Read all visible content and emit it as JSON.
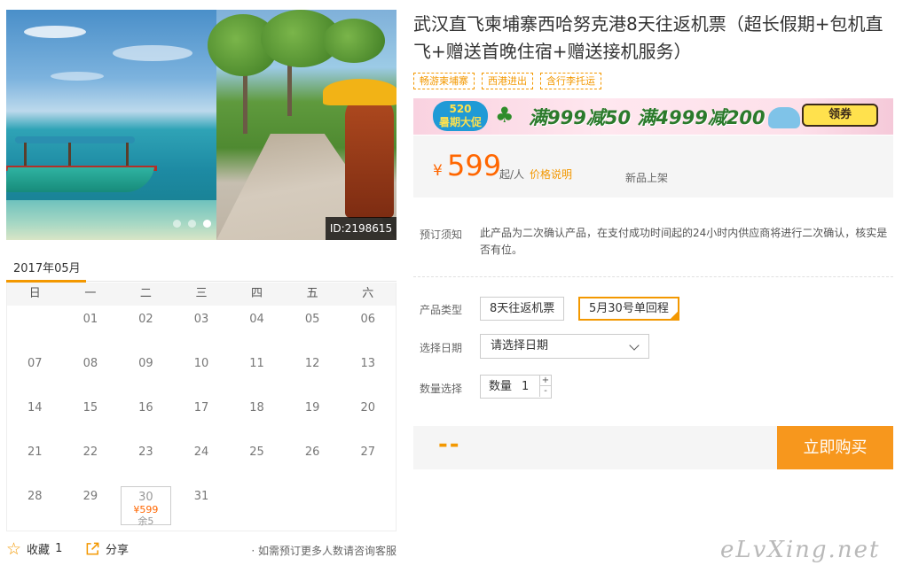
{
  "gallery": {
    "id_label": "ID:2198615",
    "dots": 3,
    "active_dot": 2
  },
  "calendar": {
    "month": "2017年05月",
    "weekdays": [
      "日",
      "一",
      "二",
      "三",
      "四",
      "五",
      "六"
    ],
    "start_offset": 1,
    "days": [
      "01",
      "02",
      "03",
      "04",
      "05",
      "06",
      "07",
      "08",
      "09",
      "10",
      "11",
      "12",
      "13",
      "14",
      "15",
      "16",
      "17",
      "18",
      "19",
      "20",
      "21",
      "22",
      "23",
      "24",
      "25",
      "26",
      "27",
      "28",
      "29",
      "30",
      "31"
    ],
    "available": {
      "30": {
        "price": "¥599",
        "stock": "余5"
      }
    }
  },
  "actions": {
    "favorite_label": "收藏",
    "favorite_count": "1",
    "share_label": "分享",
    "contact_note": "· 如需预订更多人数请咨询客服"
  },
  "product": {
    "title": "武汉直飞柬埔寨西哈努克港8天往返机票（超长假期+包机直飞+赠送首晚住宿+赠送接机服务）",
    "tags": [
      "畅游柬埔寨",
      "西港进出",
      "含行李托运"
    ]
  },
  "promo": {
    "badge_line1": "520",
    "badge_line2": "暑期大促",
    "text": "满999减50 满4999减200",
    "button": "领券"
  },
  "price": {
    "currency": "¥",
    "value": "599",
    "unit": "起/人",
    "info_link": "价格说明",
    "status": "新品上架"
  },
  "notice": {
    "label": "预订须知",
    "text": "此产品为二次确认产品，在支付成功时间起的24小时内供应商将进行二次确认，核实是否有位。"
  },
  "options": {
    "type_label": "产品类型",
    "types": [
      "8天往返机票",
      "5月30号单回程"
    ],
    "selected_type": 1,
    "date_label": "选择日期",
    "date_placeholder": "请选择日期",
    "qty_label": "数量选择",
    "qty_inner_label": "数量",
    "qty_value": "1",
    "plus": "+",
    "minus": "-"
  },
  "buy": {
    "total": "--",
    "button": "立即购买"
  },
  "watermark": "eLvXing.net",
  "colors": {
    "accent": "#f39800",
    "price": "#ff6600",
    "buy_button": "#f7971d"
  }
}
